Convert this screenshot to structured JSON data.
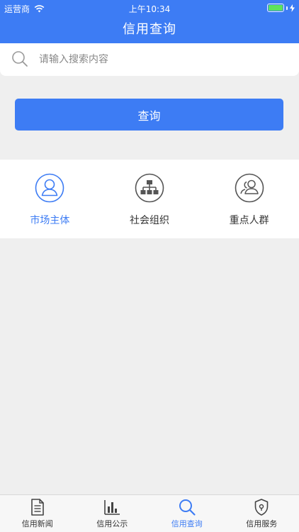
{
  "status_bar": {
    "carrier": "运营商",
    "time": "上午10:34"
  },
  "header": {
    "title": "信用查询"
  },
  "search": {
    "placeholder": "请输入搜索内容",
    "value": ""
  },
  "query_button": {
    "label": "查询"
  },
  "categories": [
    {
      "label": "市场主体",
      "icon": "person-icon",
      "active": true
    },
    {
      "label": "社会组织",
      "icon": "org-chart-icon",
      "active": false
    },
    {
      "label": "重点人群",
      "icon": "group-icon",
      "active": false
    }
  ],
  "tabbar": [
    {
      "label": "信用新闻",
      "icon": "document-icon",
      "active": false
    },
    {
      "label": "信用公示",
      "icon": "bar-chart-icon",
      "active": false
    },
    {
      "label": "信用查询",
      "icon": "search-icon",
      "active": true
    },
    {
      "label": "信用服务",
      "icon": "shield-icon",
      "active": false
    }
  ],
  "colors": {
    "primary": "#3d7cf4",
    "background": "#efefef",
    "inactive": "#555555"
  }
}
